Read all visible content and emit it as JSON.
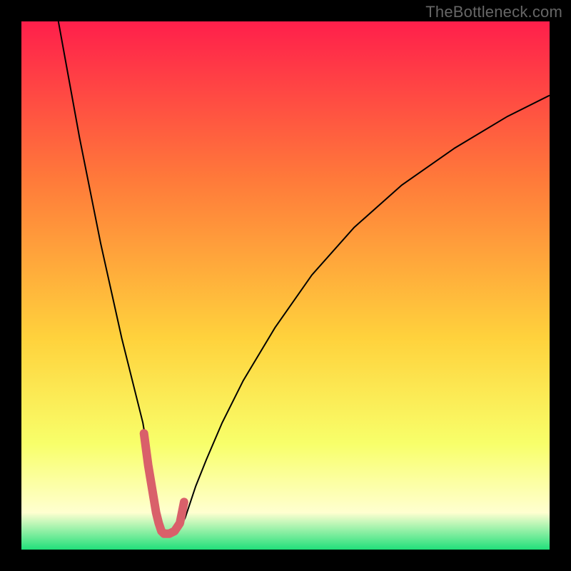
{
  "watermark": "TheBottleneck.com",
  "chart_data": {
    "type": "line",
    "title": "",
    "xlabel": "",
    "ylabel": "",
    "xlim": [
      0,
      100
    ],
    "ylim": [
      0,
      100
    ],
    "gradient_colors": {
      "top": "#ff1f4b",
      "upper_mid": "#ff7a3a",
      "mid": "#ffd23c",
      "lower_mid": "#f8ff6a",
      "pale": "#ffffd0",
      "bottom": "#21e07a"
    },
    "series": [
      {
        "name": "bottleneck-curve",
        "stroke": "#000000",
        "stroke_width": 2,
        "x": [
          7,
          9,
          11,
          13,
          15,
          17,
          19,
          21,
          23,
          24,
          25,
          25.5,
          26,
          26.5,
          27,
          28,
          29,
          30,
          31,
          32,
          33,
          35,
          38,
          42,
          48,
          55,
          63,
          72,
          82,
          92,
          100
        ],
        "y": [
          100,
          89,
          78,
          68,
          58,
          49,
          40,
          32,
          24,
          18,
          12,
          8,
          5,
          3,
          2.5,
          2.5,
          3,
          4,
          6,
          9,
          12,
          17,
          24,
          32,
          42,
          52,
          61,
          69,
          76,
          82,
          86
        ]
      },
      {
        "name": "valley-highlight",
        "stroke": "#d9606a",
        "stroke_width": 12,
        "linecap": "round",
        "x": [
          23.2,
          24,
          25,
          25.5,
          26,
          26.5,
          27,
          28,
          29,
          30,
          30.8
        ],
        "y": [
          22,
          16,
          10,
          7,
          5,
          3.5,
          3,
          3,
          3.5,
          5,
          9
        ]
      }
    ]
  }
}
